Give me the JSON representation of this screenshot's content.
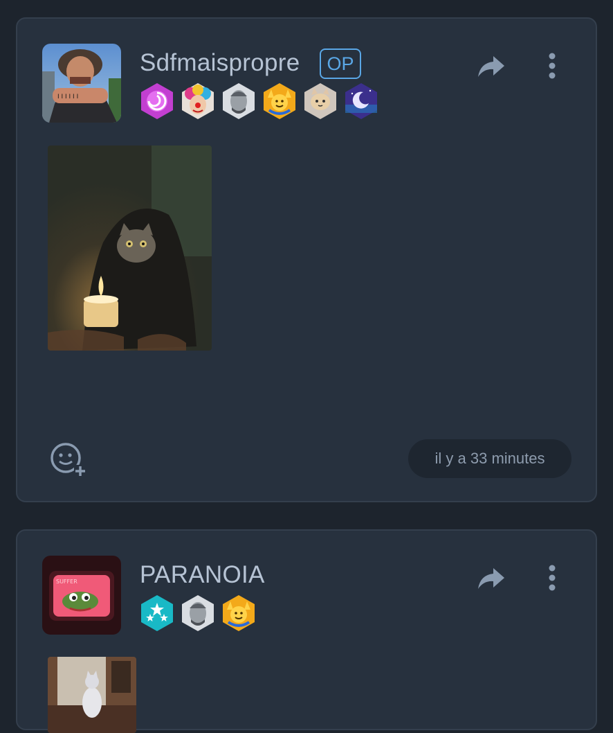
{
  "posts": [
    {
      "author": "Sdfmaispropre",
      "op_badge": "OP",
      "badges": [
        "swirl-badge",
        "clown-badge",
        "chad-badge",
        "raised-hands-badge",
        "cat-badge",
        "moon-badge"
      ],
      "media": "hooded-cat-candle-image",
      "timestamp": "il y a 33 minutes"
    },
    {
      "author": "PARANOIA",
      "badges": [
        "stars-badge",
        "chad-badge",
        "raised-hands-badge"
      ],
      "media": "cat-in-room-image",
      "avatar_text": "SUFFER"
    }
  ],
  "icons": {
    "share": "share-icon",
    "more": "more-vertical-icon",
    "react": "add-reaction-icon"
  },
  "colors": {
    "background": "#1d242d",
    "card": "#27313e",
    "accent": "#5aa7e6",
    "text": "#b6c3d4"
  }
}
